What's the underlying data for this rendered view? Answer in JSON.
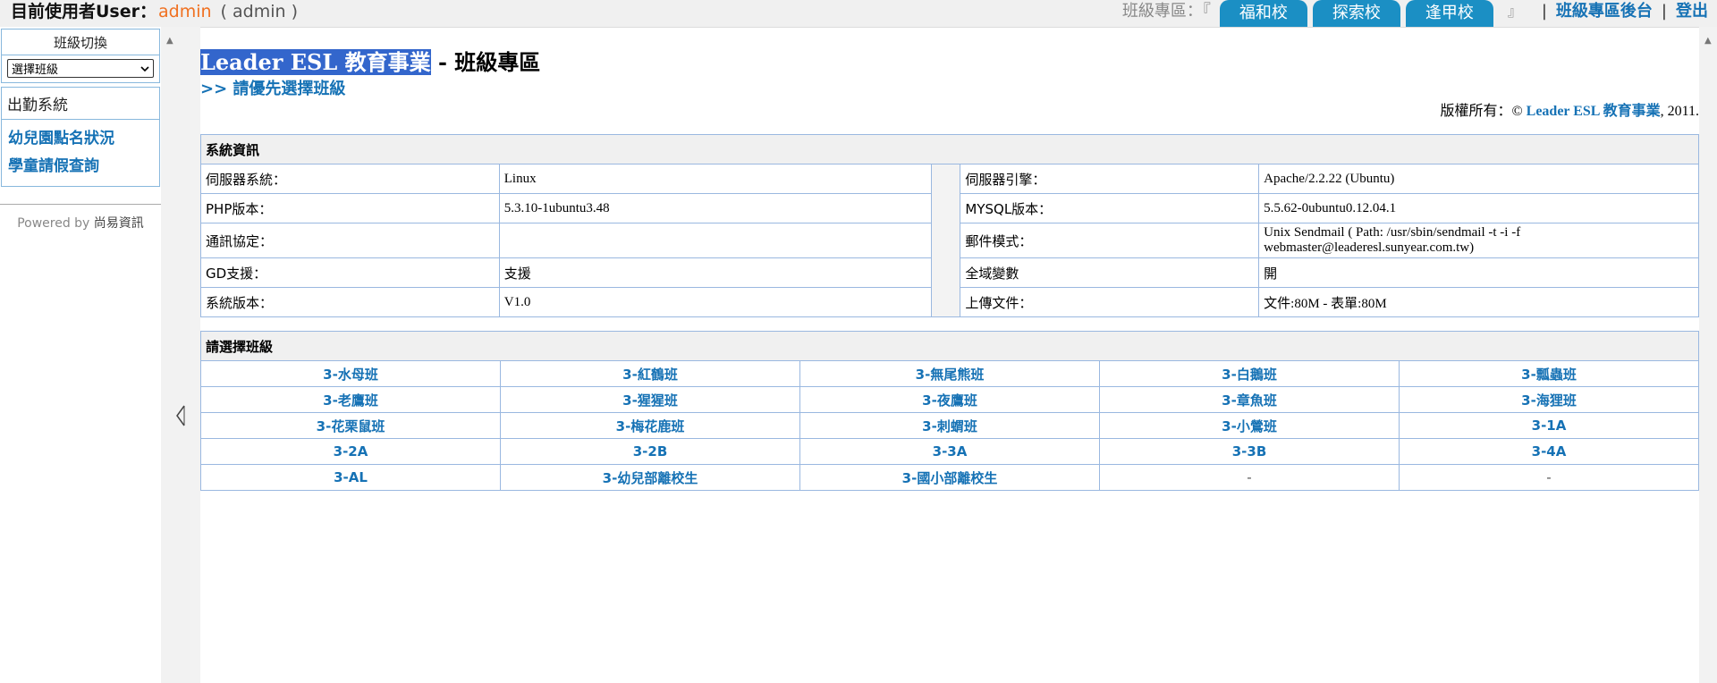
{
  "header": {
    "user_label": "目前使用者User：",
    "user_name": "admin",
    "user_paren": "( admin )",
    "zone_label": "班級專區：『",
    "tabs": [
      "福和校",
      "探索校",
      "逢甲校"
    ],
    "zone_end": "』",
    "sep": "|",
    "admin_link": "班級專區後台",
    "logout": "登出"
  },
  "sidebar": {
    "class_switch_title": "班級切換",
    "class_select_value": "選擇班級",
    "attendance_title": "出勤系統",
    "attendance_links": [
      "幼兒園點名狀況",
      "學童請假查詢"
    ],
    "powered_by": "Powered by",
    "powered_name": "尚易資訊"
  },
  "main": {
    "title_brand": "Leader ESL 教育事業",
    "title_rest": " - 班級專區",
    "notice": ">> 請優先選擇班級",
    "copyright_prefix": "版權所有：©",
    "copyright_brand": "Leader ESL 教育事業",
    "copyright_suffix": ", 2011."
  },
  "system_info": {
    "heading": "系統資訊",
    "rows": [
      [
        "伺服器系統：",
        "Linux",
        "伺服器引擎：",
        "Apache/2.2.22 (Ubuntu)"
      ],
      [
        "PHP版本：",
        "5.3.10-1ubuntu3.48",
        "MYSQL版本：",
        "5.5.62-0ubuntu0.12.04.1"
      ],
      [
        "通訊協定：",
        "",
        "郵件模式：",
        "Unix Sendmail ( Path: /usr/sbin/sendmail -t -i -f webmaster@leaderesl.sunyear.com.tw)"
      ],
      [
        "GD支援：",
        "支援",
        "全域變數",
        "開"
      ],
      [
        "系統版本：",
        "V1.0",
        "上傳文件：",
        "文件:80M - 表單:80M"
      ]
    ]
  },
  "classes": {
    "heading": "請選擇班級",
    "rows": [
      [
        "3-水母班",
        "3-紅鶴班",
        "3-無尾熊班",
        "3-白鵝班",
        "3-瓢蟲班"
      ],
      [
        "3-老鷹班",
        "3-猩猩班",
        "3-夜鷹班",
        "3-章魚班",
        "3-海狸班"
      ],
      [
        "3-花栗鼠班",
        "3-梅花鹿班",
        "3-刺蝟班",
        "3-小鶯班",
        "3-1A"
      ],
      [
        "3-2A",
        "3-2B",
        "3-3A",
        "3-3B",
        "3-4A"
      ],
      [
        "3-AL",
        "3-幼兒部離校生",
        "3-國小部離校生",
        "-",
        "-"
      ]
    ]
  },
  "colors": {
    "accent_link": "#1672b5",
    "tab_bg": "#1b8fc4",
    "user_name": "#f07020",
    "title_highlight": "#3366cc"
  }
}
